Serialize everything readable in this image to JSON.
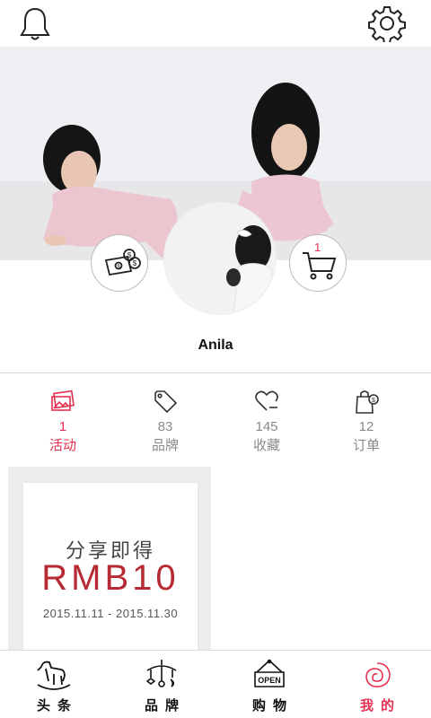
{
  "header": {
    "notification_icon": "bell-icon",
    "settings_icon": "gear-icon"
  },
  "profile": {
    "username": "Anila",
    "cart_count": "1",
    "wallet_icon": "money-icon",
    "cart_icon": "cart-icon"
  },
  "stats": [
    {
      "count": "1",
      "label": "活动",
      "icon": "photos-icon",
      "active": true
    },
    {
      "count": "83",
      "label": "品牌",
      "icon": "tag-icon",
      "active": false
    },
    {
      "count": "145",
      "label": "收藏",
      "icon": "heart-icon",
      "active": false
    },
    {
      "count": "12",
      "label": "订单",
      "icon": "shopping-bag-icon",
      "active": false
    }
  ],
  "promo_card": {
    "title": "分享即得",
    "amount": "RMB10",
    "dates": "2015.11.11 - 2015.11.30"
  },
  "tabs": [
    {
      "label": "头条",
      "icon": "rocking-horse-icon",
      "active": false
    },
    {
      "label": "品牌",
      "icon": "baby-mobile-icon",
      "active": false
    },
    {
      "label": "购物",
      "icon": "open-sign-icon",
      "active": false
    },
    {
      "label": "我的",
      "icon": "snail-icon",
      "active": true
    }
  ],
  "colors": {
    "accent": "#e5304f",
    "promo_red": "#b82a33",
    "muted": "#8a8a8a"
  }
}
